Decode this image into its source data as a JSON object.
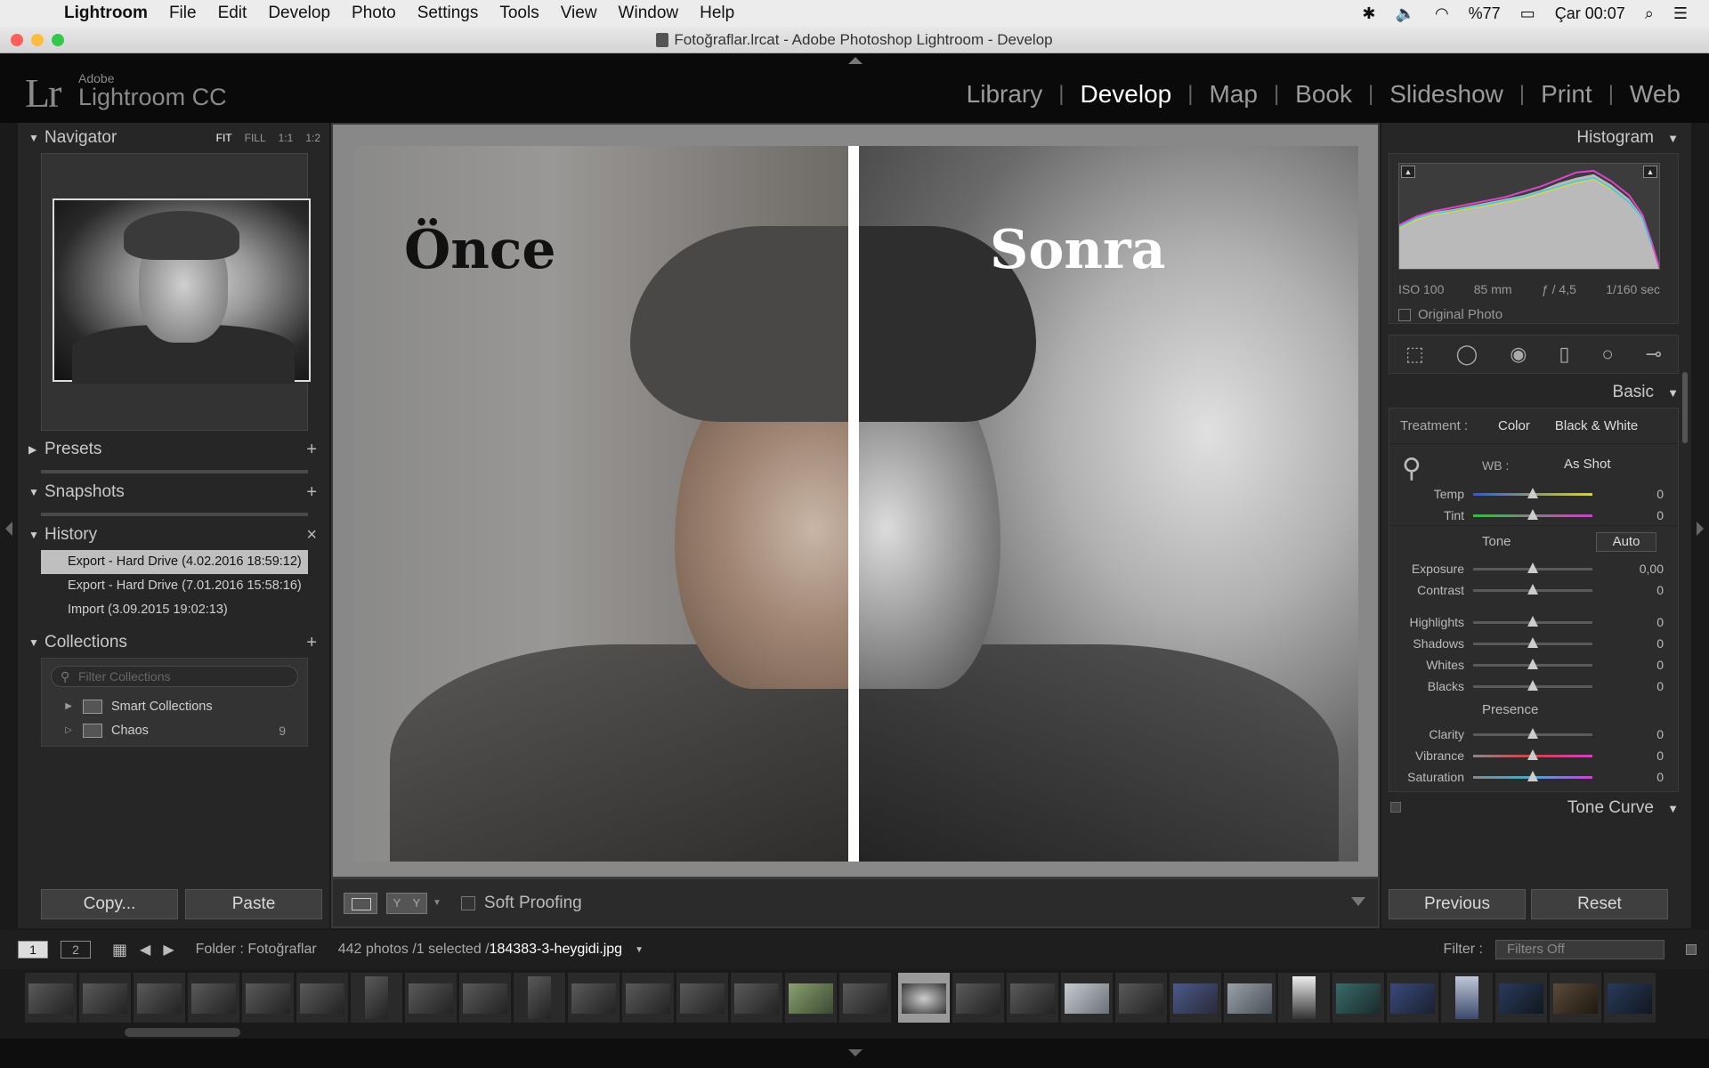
{
  "menubar": {
    "app": "Lightroom",
    "items": [
      "File",
      "Edit",
      "Develop",
      "Photo",
      "Settings",
      "Tools",
      "View",
      "Window",
      "Help"
    ],
    "battery": "%77",
    "clock": "Çar 00:07"
  },
  "window": {
    "title": "Fotoğraflar.lrcat - Adobe Photoshop Lightroom - Develop"
  },
  "identity": {
    "logo": "Lr",
    "adobe": "Adobe",
    "product": "Lightroom CC"
  },
  "modules": [
    "Library",
    "Develop",
    "Map",
    "Book",
    "Slideshow",
    "Print",
    "Web"
  ],
  "active_module": "Develop",
  "left": {
    "navigator": {
      "title": "Navigator",
      "zoom": [
        "FIT",
        "FILL",
        "1:1",
        "1:2"
      ]
    },
    "presets": "Presets",
    "snapshots": "Snapshots",
    "history": {
      "title": "History",
      "items": [
        "Export - Hard Drive (4.02.2016 18:59:12)",
        "Export - Hard Drive (7.01.2016 15:58:16)",
        "Import (3.09.2015 19:02:13)"
      ]
    },
    "collections": {
      "title": "Collections",
      "filter_placeholder": "Filter Collections",
      "items": [
        {
          "name": "Smart Collections",
          "count": ""
        },
        {
          "name": "Chaos",
          "count": "9"
        }
      ]
    },
    "copy": "Copy...",
    "paste": "Paste"
  },
  "center": {
    "before_label": "Önce",
    "after_label": "Sonra",
    "soft_proofing": "Soft Proofing"
  },
  "right": {
    "histogram": "Histogram",
    "exif": {
      "iso": "ISO 100",
      "focal": "85 mm",
      "aperture": "ƒ / 4,5",
      "shutter": "1/160 sec"
    },
    "original_photo": "Original Photo",
    "basic": "Basic",
    "treatment": {
      "label": "Treatment :",
      "color": "Color",
      "bw": "Black & White"
    },
    "wb": {
      "label": "WB :",
      "value": "As Shot"
    },
    "sliders_wb": [
      {
        "name": "Temp",
        "value": "0",
        "pos": 0.5
      },
      {
        "name": "Tint",
        "value": "0",
        "pos": 0.5
      }
    ],
    "tone": {
      "title": "Tone",
      "auto": "Auto"
    },
    "sliders_tone": [
      {
        "name": "Exposure",
        "value": "0,00",
        "pos": 0.5
      },
      {
        "name": "Contrast",
        "value": "0",
        "pos": 0.5
      }
    ],
    "sliders_light": [
      {
        "name": "Highlights",
        "value": "0",
        "pos": 0.5
      },
      {
        "name": "Shadows",
        "value": "0",
        "pos": 0.5
      },
      {
        "name": "Whites",
        "value": "0",
        "pos": 0.5
      },
      {
        "name": "Blacks",
        "value": "0",
        "pos": 0.5
      }
    ],
    "presence": {
      "title": "Presence"
    },
    "sliders_presence": [
      {
        "name": "Clarity",
        "value": "0",
        "pos": 0.5
      },
      {
        "name": "Vibrance",
        "value": "0",
        "pos": 0.5
      },
      {
        "name": "Saturation",
        "value": "0",
        "pos": 0.5
      }
    ],
    "tone_curve": "Tone Curve",
    "previous": "Previous",
    "reset": "Reset"
  },
  "filmbar": {
    "view1": "1",
    "view2": "2",
    "folder": "Folder : Fotoğraflar",
    "count": "442 photos /1 selected /",
    "file": "184383-3-heygidi.jpg",
    "filter_label": "Filter :",
    "filter_value": "Filters Off"
  },
  "colors": {
    "accent": "#ffffff",
    "panel": "#262626",
    "background": "#1a1a1a"
  }
}
